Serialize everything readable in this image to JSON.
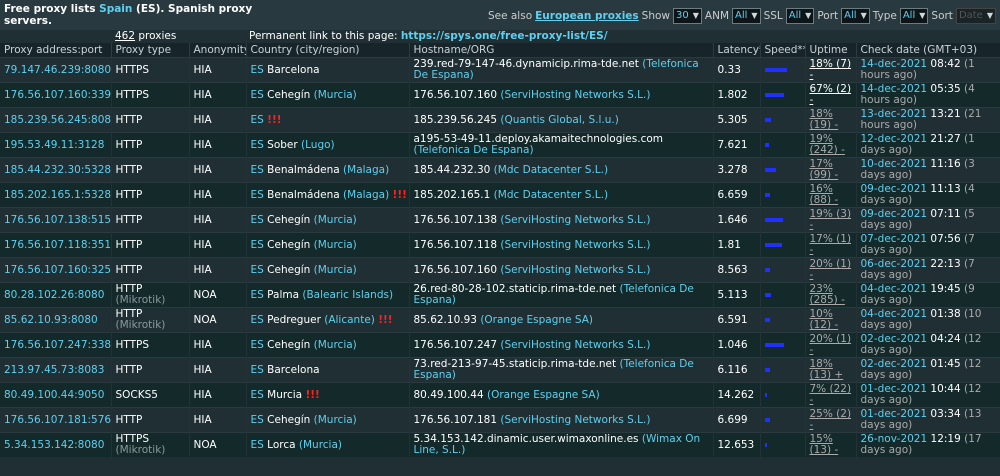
{
  "header": {
    "title_pre": "Free proxy lists ",
    "title_country": "Spain",
    "title_post": " (ES). Spanish proxy servers.",
    "see_also": "See also",
    "european": "European proxies",
    "show_label": "Show",
    "show_value": "30",
    "anm_label": "ANM",
    "anm_value": "All",
    "ssl_label": "SSL",
    "ssl_value": "All",
    "port_label": "Port",
    "port_value": "All",
    "type_label": "Type",
    "type_value": "All",
    "sort_label": "Sort",
    "sort_value": "Date"
  },
  "count": {
    "num": "462",
    "text": " proxies"
  },
  "permalink": {
    "label": "Permanent link to this page: ",
    "url": "https://spys.one/free-proxy-list/ES/"
  },
  "columns": [
    "Proxy address:port",
    "Proxy type",
    "Anonymity*",
    "Country (city/region)",
    "Hostname/ORG",
    "Latency**",
    "Speed***",
    "Uptime",
    "Check date (GMT+03)"
  ],
  "rows": [
    {
      "ip": "79.147.46.239:8080",
      "type": "HTTPS",
      "type_x": "",
      "anon": "HIA",
      "cc": "ES",
      "city": "Barcelona",
      "region": "",
      "warn": "",
      "host": "239.red-79-147-46.dynamicip.rima-tde.net",
      "org": "(Telefonica De Espana)",
      "lat": "0.33",
      "speed": 0.9,
      "uptime": "18% (7) -",
      "up_hi": true,
      "date": "14-dec-2021",
      "time": " 08:42",
      "ago": "(1 hours ago)"
    },
    {
      "ip": "176.56.107.160:33911",
      "type": "HTTPS",
      "type_x": "",
      "anon": "HIA",
      "cc": "ES",
      "city": "Cehegín",
      "region": "(Murcia)",
      "warn": "",
      "host": "176.56.107.160",
      "org": "(ServiHosting Networks S.L.)",
      "lat": "1.802",
      "speed": 0.8,
      "uptime": "67% (2) -",
      "up_hi": true,
      "date": "14-dec-2021",
      "time": " 05:35",
      "ago": "(4 hours ago)"
    },
    {
      "ip": "185.239.56.245:8083",
      "type": "HTTP",
      "type_x": "",
      "anon": "HIA",
      "cc": "ES",
      "city": "",
      "region": "",
      "warn": "!!!",
      "host": "185.239.56.245",
      "org": "(Quantis Global, S.l.u.)",
      "lat": "5.305",
      "speed": 0.25,
      "uptime": "18% (19) -",
      "up_hi": false,
      "date": "13-dec-2021",
      "time": " 13:21",
      "ago": "(21 hours ago)"
    },
    {
      "ip": "195.53.49.11:3128",
      "type": "HTTP",
      "type_x": "",
      "anon": "HIA",
      "cc": "ES",
      "city": "Sober",
      "region": "(Lugo)",
      "warn": "",
      "host": "a195-53-49-11.deploy.akamaitechnologies.com",
      "org": "(Telefonica De Espana)",
      "lat": "7.621",
      "speed": 0.15,
      "uptime": "19% (242) -",
      "up_hi": false,
      "date": "12-dec-2021",
      "time": " 21:27",
      "ago": "(1 days ago)"
    },
    {
      "ip": "185.44.232.30:53281",
      "type": "HTTP",
      "type_x": "",
      "anon": "HIA",
      "cc": "ES",
      "city": "Benalmádena",
      "region": "(Malaga)",
      "warn": "",
      "host": "185.44.232.30",
      "org": "(Mdc Datacenter S.L.)",
      "lat": "3.278",
      "speed": 0.45,
      "uptime": "17% (99) -",
      "up_hi": false,
      "date": "10-dec-2021",
      "time": " 11:16",
      "ago": "(3 days ago)"
    },
    {
      "ip": "185.202.165.1:53281",
      "type": "HTTP",
      "type_x": "",
      "anon": "HIA",
      "cc": "ES",
      "city": "Benalmádena",
      "region": "(Malaga)",
      "warn": "!!!",
      "host": "185.202.165.1",
      "org": "(Mdc Datacenter S.L.)",
      "lat": "6.659",
      "speed": 0.2,
      "uptime": "16% (88) -",
      "up_hi": false,
      "date": "09-dec-2021",
      "time": " 11:13",
      "ago": "(4 days ago)"
    },
    {
      "ip": "176.56.107.138:51528",
      "type": "HTTP",
      "type_x": "",
      "anon": "HIA",
      "cc": "ES",
      "city": "Cehegín",
      "region": "(Murcia)",
      "warn": "",
      "host": "176.56.107.138",
      "org": "(ServiHosting Networks S.L.)",
      "lat": "1.646",
      "speed": 0.75,
      "uptime": "19% (3) -",
      "up_hi": false,
      "date": "09-dec-2021",
      "time": " 07:11",
      "ago": "(5 days ago)"
    },
    {
      "ip": "176.56.107.118:35186",
      "type": "HTTP",
      "type_x": "",
      "anon": "HIA",
      "cc": "ES",
      "city": "Cehegín",
      "region": "(Murcia)",
      "warn": "",
      "host": "176.56.107.118",
      "org": "(ServiHosting Networks S.L.)",
      "lat": "1.81",
      "speed": 0.7,
      "uptime": "17% (1) -",
      "up_hi": false,
      "date": "07-dec-2021",
      "time": " 07:56",
      "ago": "(7 days ago)"
    },
    {
      "ip": "176.56.107.160:32585",
      "type": "HTTP",
      "type_x": "",
      "anon": "HIA",
      "cc": "ES",
      "city": "Cehegín",
      "region": "(Murcia)",
      "warn": "",
      "host": "176.56.107.160",
      "org": "(ServiHosting Networks S.L.)",
      "lat": "8.563",
      "speed": 0.2,
      "uptime": "20% (1) -",
      "up_hi": false,
      "date": "06-dec-2021",
      "time": " 22:13",
      "ago": "(7 days ago)"
    },
    {
      "ip": "80.28.102.26:8080",
      "type": "HTTP",
      "type_x": "(Mikrotik)",
      "anon": "NOA",
      "cc": "ES",
      "city": "Palma",
      "region": "(Balearic Islands)",
      "warn": "",
      "host": "26.red-80-28-102.staticip.rima-tde.net",
      "org": "(Telefonica De Espana)",
      "lat": "5.113",
      "speed": 0.25,
      "uptime": "23% (285) -",
      "up_hi": false,
      "date": "04-dec-2021",
      "time": " 19:45",
      "ago": "(9 days ago)"
    },
    {
      "ip": "85.62.10.93:8080",
      "type": "HTTP",
      "type_x": "(Mikrotik)",
      "anon": "NOA",
      "cc": "ES",
      "city": "Pedreguer",
      "region": "(Alicante)",
      "warn": "!!!",
      "host": "85.62.10.93",
      "org": "(Orange Espagne SA)",
      "lat": "6.591",
      "speed": 0.2,
      "uptime": "10% (12) -",
      "up_hi": false,
      "date": "04-dec-2021",
      "time": " 01:38",
      "ago": "(10 days ago)"
    },
    {
      "ip": "176.56.107.247:33831",
      "type": "HTTPS",
      "type_x": "",
      "anon": "HIA",
      "cc": "ES",
      "city": "Cehegín",
      "region": "(Murcia)",
      "warn": "",
      "host": "176.56.107.247",
      "org": "(ServiHosting Networks S.L.)",
      "lat": "1.046",
      "speed": 0.8,
      "uptime": "20% (1) -",
      "up_hi": false,
      "date": "02-dec-2021",
      "time": " 04:24",
      "ago": "(12 days ago)"
    },
    {
      "ip": "213.97.45.73:8083",
      "type": "HTTP",
      "type_x": "",
      "anon": "HIA",
      "cc": "ES",
      "city": "Barcelona",
      "region": "",
      "warn": "",
      "host": "73.red-213-97-45.staticip.rima-tde.net",
      "org": "(Telefonica De Espana)",
      "lat": "6.116",
      "speed": 0.2,
      "uptime": "18% (13) +",
      "up_hi": false,
      "date": "02-dec-2021",
      "time": " 01:45",
      "ago": "(12 days ago)"
    },
    {
      "ip": "80.49.100.44:9050",
      "type": "SOCKS5",
      "type_x": "",
      "anon": "HIA",
      "cc": "ES",
      "city": "Murcia",
      "region": "",
      "warn": "!!!",
      "host": "80.49.100.44",
      "org": "(Orange Espagne SA)",
      "lat": "14.262",
      "speed": 0.1,
      "uptime": "7% (22) -",
      "up_hi": false,
      "date": "01-dec-2021",
      "time": " 10:44",
      "ago": "(12 days ago)"
    },
    {
      "ip": "176.56.107.181:57628",
      "type": "HTTP",
      "type_x": "",
      "anon": "HIA",
      "cc": "ES",
      "city": "Cehegín",
      "region": "(Murcia)",
      "warn": "",
      "host": "176.56.107.181",
      "org": "(ServiHosting Networks S.L.)",
      "lat": "6.699",
      "speed": 0.2,
      "uptime": "25% (2) -",
      "up_hi": false,
      "date": "01-dec-2021",
      "time": " 03:34",
      "ago": "(13 days ago)"
    },
    {
      "ip": "5.34.153.142:8080",
      "type": "HTTPS",
      "type_x": "(Mikrotik)",
      "anon": "NOA",
      "cc": "ES",
      "city": "Lorca",
      "region": "(Murcia)",
      "warn": "",
      "host": "5.34.153.142.dinamic.user.wimaxonline.es",
      "org": "(Wimax On Line, S.L.)",
      "lat": "12.653",
      "speed": 0.1,
      "uptime": "15% (13) -",
      "up_hi": false,
      "date": "26-nov-2021",
      "time": " 12:19",
      "ago": "(17 days ago)"
    }
  ],
  "colors": {
    "accent": "#5fd0ef",
    "bg": "#1f2f34",
    "warn": "#ff2020",
    "speed_bar": "#2030ff"
  }
}
